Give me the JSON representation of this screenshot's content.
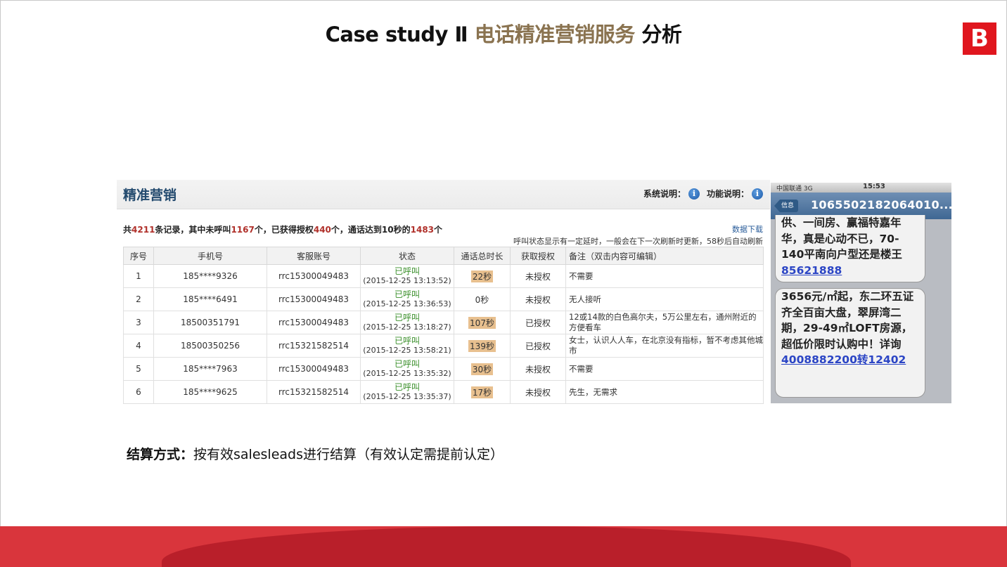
{
  "slide": {
    "title_prefix": "Case study Ⅱ ",
    "title_highlight": "电话精准营销服务",
    "title_suffix": " 分析",
    "logo_letter": "B",
    "accent_color": "#e0161e",
    "title_highlight_color": "#8a7350"
  },
  "panel": {
    "title": "精准营销",
    "system_help": "系统说明：",
    "function_help": "功能说明：",
    "summary": {
      "t1": "共",
      "total": "4211",
      "t2": "条记录，其中未呼叫",
      "uncalled": "1167",
      "t3": "个，已获得授权",
      "authorized": "440",
      "t4": "个，通话达到10秒的",
      "over10s": "1483",
      "t5": "个"
    },
    "download": "数据下载",
    "note": "呼叫状态显示有一定延时，一般会在下一次刷新时更新，58秒后自动刷新",
    "columns": [
      "序号",
      "手机号",
      "客服账号",
      "状态",
      "通话总时长",
      "获取授权",
      "备注（双击内容可编辑）"
    ],
    "rows": [
      {
        "no": "1",
        "phone": "185****9326",
        "account": "rrc15300049483",
        "status": "已呼叫",
        "time": "(2015-12-25 13:13:52)",
        "duration": "22秒",
        "auth": "未授权",
        "remark": "不需要"
      },
      {
        "no": "2",
        "phone": "185****6491",
        "account": "rrc15300049483",
        "status": "已呼叫",
        "time": "(2015-12-25 13:36:53)",
        "duration": "0秒",
        "auth": "未授权",
        "remark": "无人接听"
      },
      {
        "no": "3",
        "phone": "18500351791",
        "account": "rrc15300049483",
        "status": "已呼叫",
        "time": "(2015-12-25 13:18:27)",
        "duration": "107秒",
        "auth": "已授权",
        "remark": "12或14款的白色高尔夫，5万公里左右，通州附近的方便看车"
      },
      {
        "no": "4",
        "phone": "18500350256",
        "account": "rrc15321582514",
        "status": "已呼叫",
        "time": "(2015-12-25 13:58:21)",
        "duration": "139秒",
        "auth": "已授权",
        "remark": "女士，认识人人车，在北京没有指标，暂不考虑其他城市"
      },
      {
        "no": "5",
        "phone": "185****7963",
        "account": "rrc15300049483",
        "status": "已呼叫",
        "time": "(2015-12-25 13:35:32)",
        "duration": "30秒",
        "auth": "未授权",
        "remark": "不需要"
      },
      {
        "no": "6",
        "phone": "185****9625",
        "account": "rrc15321582514",
        "status": "已呼叫",
        "time": "(2015-12-25 13:35:37)",
        "duration": "17秒",
        "auth": "未授权",
        "remark": "先生，无需求"
      }
    ]
  },
  "phone": {
    "carrier": "中国联通 3G",
    "clock": "15:53",
    "back_label": "信息",
    "sender": "1065502182064010...",
    "sms1_text": "供、一间房、赢福特嘉年华，真是心动不已，70-140平南向户型还是楼王",
    "sms1_link": "85621888",
    "sms2_text": "3656元/㎡起，东二环五证齐全百亩大盘，翠屏湾二期，29-49㎡LOFT房源，超低价限时认购中！详询",
    "sms2_link": "4008882200转12402"
  },
  "settlement": {
    "label": "结算方式：",
    "text": "按有效salesleads进行结算（有效认定需提前认定）"
  }
}
